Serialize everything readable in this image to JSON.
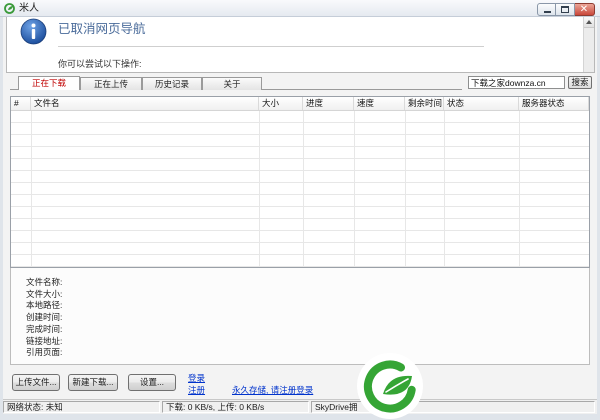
{
  "window": {
    "title": "米人",
    "app_icon": "app-leaf-icon",
    "controls": {
      "minimize": "minimize-icon",
      "maximize": "maximize-icon",
      "close": "close-icon"
    }
  },
  "browser": {
    "icon": "info-icon",
    "heading": "已取消网页导航",
    "hint": "你可以尝试以下操作:"
  },
  "tabs": [
    {
      "label": "正在下载",
      "active": true
    },
    {
      "label": "正在上传",
      "active": false
    },
    {
      "label": "历史记录",
      "active": false
    },
    {
      "label": "关于",
      "active": false
    }
  ],
  "search": {
    "value": "下载之家downza.cn",
    "button_label": "搜索"
  },
  "download_list": {
    "columns": [
      "#",
      "文件名",
      "大小",
      "进度",
      "速度",
      "剩余时间",
      "状态",
      "服务器状态"
    ],
    "rows": []
  },
  "details": {
    "labels": [
      "文件名称:",
      "文件大小:",
      "本地路径:",
      "创建时间:",
      "完成时间:",
      "链接地址:",
      "引用页面:"
    ]
  },
  "actions": {
    "upload_label": "上传文件...",
    "new_download_label": "新建下载...",
    "settings_label": "设置..."
  },
  "account_links": {
    "login": "登录",
    "register": "注册",
    "promo": "永久存储, 请注册登录"
  },
  "status_bar": {
    "network": "网络状态: 未知",
    "speed": "下载: 0 KB/s, 上传: 0 KB/s",
    "skydrive": "SkyDrive拥"
  },
  "watermark": {
    "icon": "green-leaf-logo-icon"
  },
  "colors": {
    "link": "#0033cc",
    "active_tab": "#c00000",
    "close_button": "#c9483b",
    "logo_green": "#35a535",
    "heading": "#4a6b9a"
  }
}
